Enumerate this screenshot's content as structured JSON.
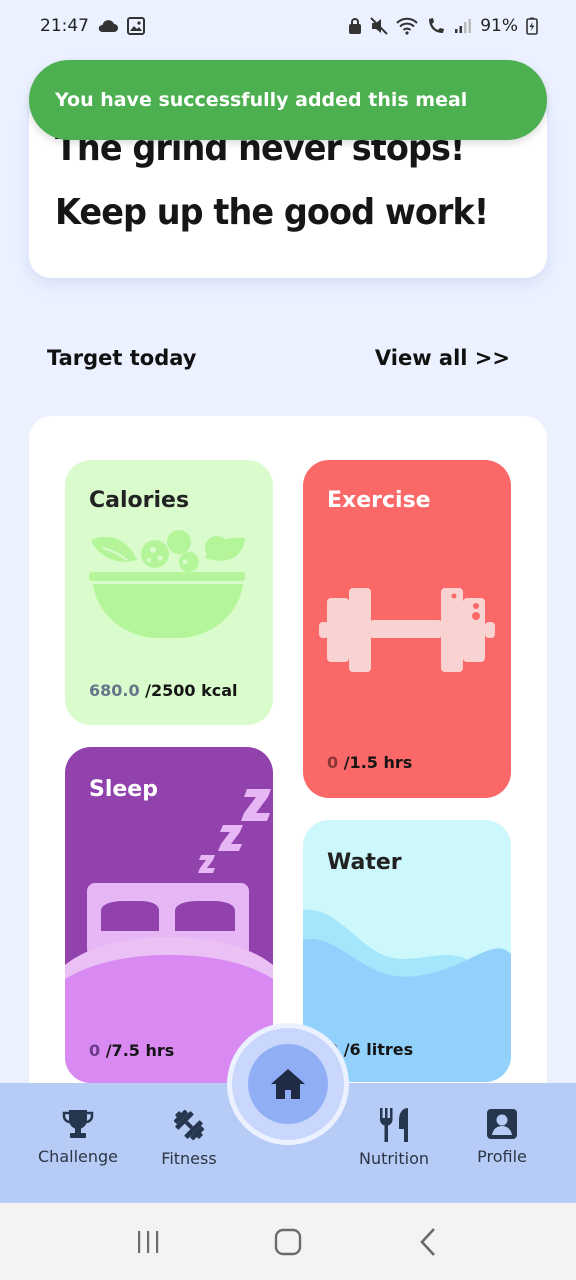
{
  "status_bar": {
    "time": "21:47",
    "battery": "91%",
    "icons": [
      "cloud-icon",
      "image-icon",
      "lock-icon",
      "mute-icon",
      "wifi-icon",
      "wifi-call-icon",
      "signal-icon",
      "battery-icon"
    ]
  },
  "toast": {
    "message": "You have successfully added this meal",
    "color": "#4caf50"
  },
  "motivation": {
    "line1": "The grind never stops!",
    "line2": "Keep up the good work!"
  },
  "section": {
    "title": "Target today",
    "view_all": "View all >>"
  },
  "tiles": {
    "calories": {
      "title": "Calories",
      "current": "680.0",
      "target": " /2500 kcal",
      "icon": "salad-bowl-icon",
      "color": "#dafccc"
    },
    "exercise": {
      "title": "Exercise",
      "current": "0",
      "target": " /1.5 hrs",
      "icon": "dumbbell-icon",
      "color": "#fb6868"
    },
    "sleep": {
      "title": "Sleep",
      "current": "0",
      "target": " /7.5 hrs",
      "icon": "bed-icon",
      "color": "#9142ad"
    },
    "water": {
      "title": "Water",
      "current": "0",
      "target": " /6 litres",
      "icon": "water-wave-icon",
      "color": "#cdf8fb"
    }
  },
  "bottom_nav": {
    "items": [
      {
        "label": "Challenge",
        "icon": "trophy-icon"
      },
      {
        "label": "Fitness",
        "icon": "dumbbell-icon"
      },
      {
        "label": "Nutrition",
        "icon": "fork-knife-icon"
      },
      {
        "label": "Profile",
        "icon": "profile-icon"
      }
    ],
    "home_icon": "home-icon",
    "background": "#b6cbf5"
  },
  "system_nav": {
    "buttons": [
      "recents-icon",
      "home-outline-icon",
      "back-icon"
    ]
  }
}
